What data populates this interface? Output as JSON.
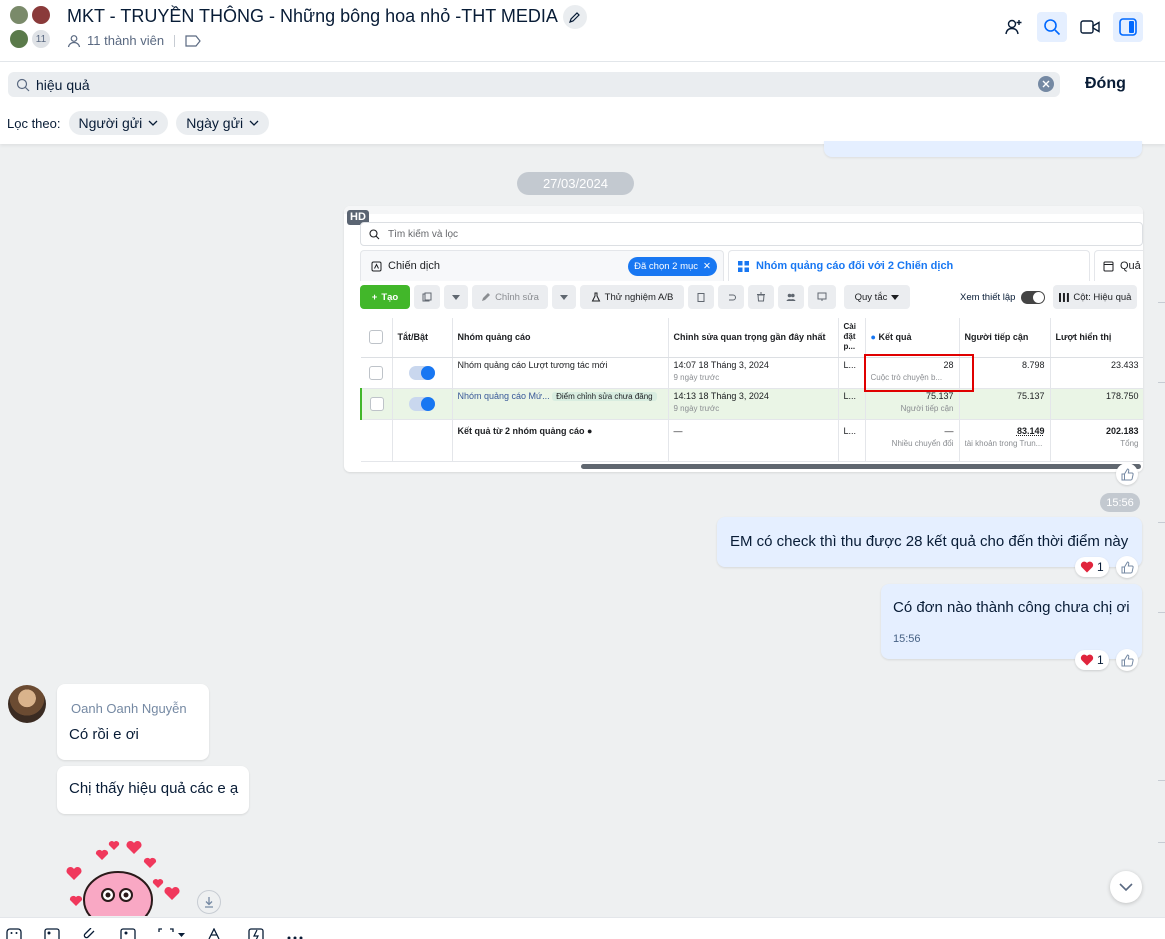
{
  "header": {
    "title": "MKT - TRUYỀN THÔNG - Những bông hoa nhỏ -THT MEDIA",
    "avatar_count": "11",
    "members": "11 thành viên"
  },
  "search": {
    "query": "hiệu quả",
    "close_label": "Đóng",
    "filter_label": "Lọc theo:",
    "filters": [
      "Người gửi",
      "Ngày gửi"
    ]
  },
  "date_divider": "27/03/2024",
  "screenshot": {
    "hd_label": "HD",
    "search_placeholder": "Tìm kiếm và lọc",
    "tab_campaign": "Chiến dịch",
    "selected_chip": "Đã chọn 2 mục",
    "tab_adsets": "Nhóm quảng cáo đối với 2 Chiến dịch",
    "tab_ads": "Quả",
    "toolbar": {
      "create": "Tạo",
      "edit": "Chỉnh sửa",
      "ab_test": "Thử nghiệm A/B",
      "rules": "Quy tắc",
      "view_setup": "Xem thiết lập",
      "columns": "Cột: Hiệu quả"
    },
    "columns": [
      "Tắt/Bật",
      "Nhóm quảng cáo",
      "Chỉnh sửa quan trọng gần đây nhất",
      "Cài đặt p...",
      "Kết quả",
      "Người tiếp cận",
      "Lượt hiển thị"
    ],
    "rows": [
      {
        "name": "Nhóm quảng cáo Lượt tương tác mới",
        "edit_time": "14:07 18 Tháng 3, 2024",
        "edit_ago": "9 ngày trước",
        "setting": "L...",
        "result": "28",
        "result_sub": "Cuộc trò chuyện b...",
        "reach": "8.798",
        "impressions": "23.433"
      },
      {
        "name": "Nhóm quảng cáo Mứ...",
        "badge": "Điểm chỉnh sửa chưa đăng",
        "edit_time": "14:13 18 Tháng 3, 2024",
        "edit_ago": "9 ngày trước",
        "setting": "L...",
        "result": "75.137",
        "result_sub": "Người tiếp cận",
        "reach": "75.137",
        "impressions": "178.750"
      }
    ],
    "total": {
      "label": "Kết quả từ 2 nhóm quảng cáo",
      "edit": "—",
      "setting": "L...",
      "result": "—",
      "result_sub": "Nhiều chuyển đổi",
      "reach": "83.149",
      "reach_sub": "tài khoản trong Trun...",
      "impressions": "202.183",
      "impressions_sub": "Tổng"
    }
  },
  "messages": [
    {
      "time": "15:56"
    },
    {
      "text": "EM có check thì thu được 28 kết quả cho đến thời điểm này",
      "reaction_count": "1"
    },
    {
      "text": "Có đơn nào thành công chưa chị ơi",
      "time": "15:56",
      "reaction_count": "1"
    },
    {
      "sender": "Oanh Oanh Nguyễn",
      "text": "Có rồi e ơi"
    },
    {
      "text": "Chị thấy hiệu quả các e ạ"
    }
  ],
  "colors": {
    "accent": "#0068ff",
    "bubble_mine": "#e5efff",
    "heart": "#e0243c"
  }
}
